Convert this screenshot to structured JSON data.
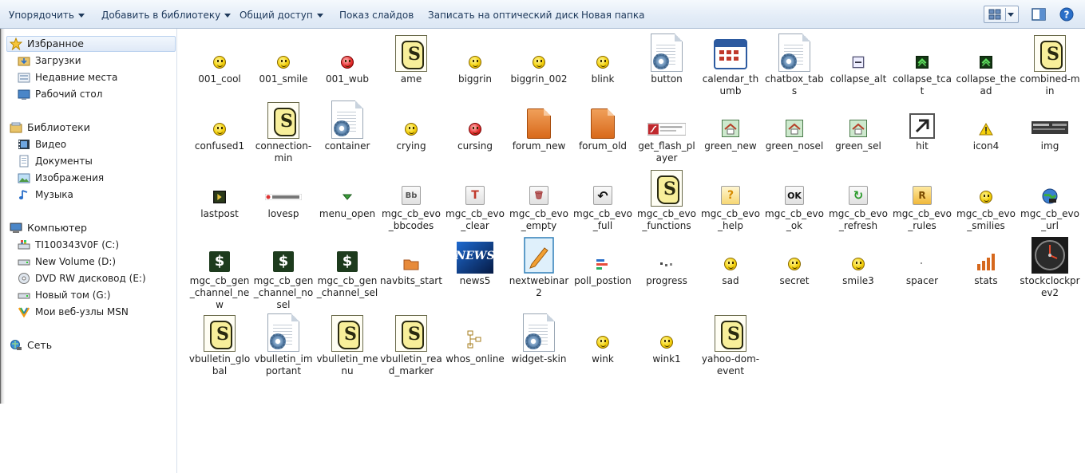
{
  "toolbar": {
    "organize": "Упорядочить",
    "add_to_library": "Добавить в библиотеку",
    "share": "Общий доступ",
    "slideshow": "Показ слайдов",
    "burn": "Записать на оптический диск",
    "new_folder": "Новая папка"
  },
  "sidebar": {
    "favorites": "Избранное",
    "downloads": "Загрузки",
    "recent": "Недавние места",
    "desktop": "Рабочий стол",
    "libraries": "Библиотеки",
    "video": "Видео",
    "documents": "Документы",
    "images": "Изображения",
    "music": "Музыка",
    "computer": "Компьютер",
    "drive_c": "TI100343V0F (C:)",
    "drive_d": "New Volume (D:)",
    "drive_e": "DVD RW дисковод (E:)",
    "drive_g": "Новый том (G:)",
    "msn": "Мои веб-узлы MSN",
    "network": "Сеть"
  },
  "files": [
    {
      "label": "001_cool",
      "icon": "smiley-icon"
    },
    {
      "label": "001_smile",
      "icon": "smiley-icon"
    },
    {
      "label": "001_wub",
      "icon": "smiley-red-icon"
    },
    {
      "label": "ame",
      "icon": "script-icon"
    },
    {
      "label": "biggrin",
      "icon": "smiley-icon"
    },
    {
      "label": "biggrin_002",
      "icon": "smiley-icon"
    },
    {
      "label": "blink",
      "icon": "smiley-icon"
    },
    {
      "label": "button",
      "icon": "config-file-icon"
    },
    {
      "label": "calendar_thumb",
      "icon": "calendar-icon"
    },
    {
      "label": "chatbox_tabs",
      "icon": "config-file-icon"
    },
    {
      "label": "collapse_alt",
      "icon": "collapse-icon"
    },
    {
      "label": "collapse_tcat",
      "icon": "collapse-green-icon"
    },
    {
      "label": "collapse_thead",
      "icon": "collapse-green-icon"
    },
    {
      "label": "combined-min",
      "icon": "script-icon"
    },
    {
      "label": "confused1",
      "icon": "smiley-icon"
    },
    {
      "label": "connection-min",
      "icon": "script-icon"
    },
    {
      "label": "container",
      "icon": "config-file-icon"
    },
    {
      "label": "crying",
      "icon": "smiley-icon"
    },
    {
      "label": "cursing",
      "icon": "smiley-red-icon"
    },
    {
      "label": "forum_new",
      "icon": "forum-icon"
    },
    {
      "label": "forum_old",
      "icon": "forum-icon"
    },
    {
      "label": "get_flash_player",
      "icon": "flash-icon"
    },
    {
      "label": "green_new",
      "icon": "green-home-icon"
    },
    {
      "label": "green_nosel",
      "icon": "green-home-icon"
    },
    {
      "label": "green_sel",
      "icon": "green-home-icon"
    },
    {
      "label": "hit",
      "icon": "arrow-box-icon"
    },
    {
      "label": "icon4",
      "icon": "warning-icon"
    },
    {
      "label": "img",
      "icon": "banner-icon"
    },
    {
      "label": "lastpost",
      "icon": "lastpost-icon"
    },
    {
      "label": "lovesp",
      "icon": "banner-small-icon"
    },
    {
      "label": "menu_open",
      "icon": "menu-open-icon"
    },
    {
      "label": "mgc_cb_evo_bbcodes",
      "icon": "bbcode-icon"
    },
    {
      "label": "mgc_cb_evo_clear",
      "icon": "clear-icon"
    },
    {
      "label": "mgc_cb_evo_empty",
      "icon": "trash-icon"
    },
    {
      "label": "mgc_cb_evo_full",
      "icon": "undo-icon"
    },
    {
      "label": "mgc_cb_evo_functions",
      "icon": "script-icon"
    },
    {
      "label": "mgc_cb_evo_help",
      "icon": "help-icon"
    },
    {
      "label": "mgc_cb_evo_ok",
      "icon": "ok-icon"
    },
    {
      "label": "mgc_cb_evo_refresh",
      "icon": "refresh-icon"
    },
    {
      "label": "mgc_cb_evo_rules",
      "icon": "rules-icon"
    },
    {
      "label": "mgc_cb_evo_smilies",
      "icon": "smiley-icon"
    },
    {
      "label": "mgc_cb_evo_url",
      "icon": "globe-icon"
    },
    {
      "label": "mgc_cb_gen_channel_new",
      "icon": "dollar-icon"
    },
    {
      "label": "mgc_cb_gen_channel_nosel",
      "icon": "dollar-icon"
    },
    {
      "label": "mgc_cb_gen_channel_sel",
      "icon": "dollar-icon"
    },
    {
      "label": "navbits_start",
      "icon": "folder-icon"
    },
    {
      "label": "news5",
      "icon": "news-icon"
    },
    {
      "label": "nextwebinar2",
      "icon": "pen-doc-icon"
    },
    {
      "label": "poll_postion",
      "icon": "poll-icon"
    },
    {
      "label": "progress",
      "icon": "progress-icon"
    },
    {
      "label": "sad",
      "icon": "smiley-icon"
    },
    {
      "label": "secret",
      "icon": "smiley-icon"
    },
    {
      "label": "smile3",
      "icon": "smiley-icon"
    },
    {
      "label": "spacer",
      "icon": "spacer-icon"
    },
    {
      "label": "stats",
      "icon": "stats-icon"
    },
    {
      "label": "stockclockprev2",
      "icon": "clock-icon"
    },
    {
      "label": "vbulletin_global",
      "icon": "script-icon"
    },
    {
      "label": "vbulletin_important",
      "icon": "config-file-icon"
    },
    {
      "label": "vbulletin_menu",
      "icon": "script-icon"
    },
    {
      "label": "vbulletin_read_marker",
      "icon": "script-icon"
    },
    {
      "label": "whos_online",
      "icon": "tree-icon"
    },
    {
      "label": "widget-skin",
      "icon": "config-file-icon"
    },
    {
      "label": "wink",
      "icon": "smiley-icon"
    },
    {
      "label": "wink1",
      "icon": "smiley-icon"
    },
    {
      "label": "yahoo-dom-event",
      "icon": "script-icon"
    }
  ]
}
